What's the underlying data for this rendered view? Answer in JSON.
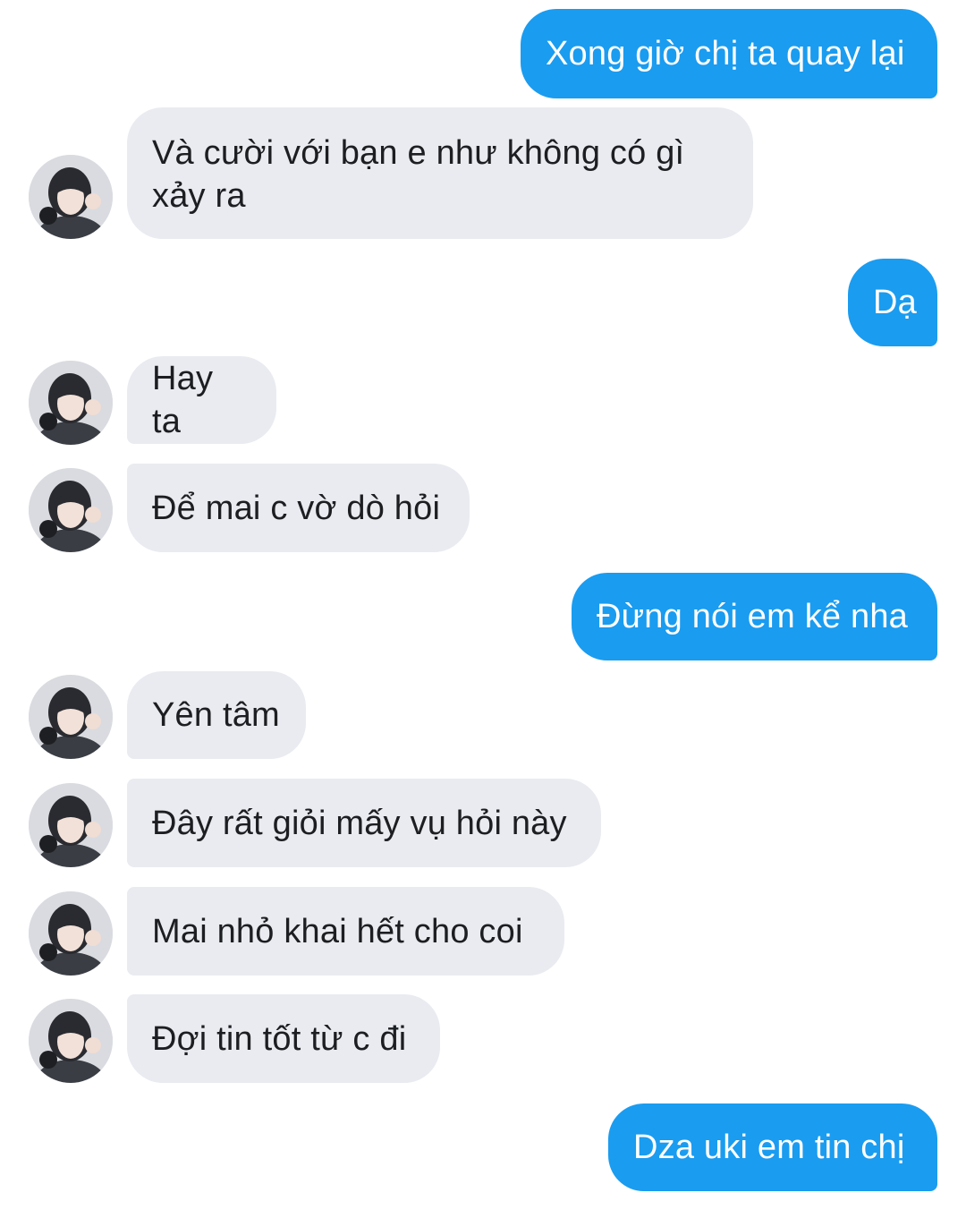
{
  "colors": {
    "outgoing_bubble": "#1a9cf0",
    "incoming_bubble": "#e9ebf0",
    "incoming_text": "#1c1e21",
    "outgoing_text": "#ffffff"
  },
  "messages": [
    {
      "sender": "me",
      "text": "Xong giờ chị ta quay lại"
    },
    {
      "sender": "other",
      "text": "Và cười với bạn e như không có gì\nxảy ra",
      "avatar": "profile-photo"
    },
    {
      "sender": "me",
      "text": "Dạ"
    },
    {
      "sender": "other",
      "text": "Hay ta",
      "avatar": "profile-photo"
    },
    {
      "sender": "other",
      "text": "Để mai c vờ dò hỏi",
      "avatar": "profile-photo"
    },
    {
      "sender": "me",
      "text": "Đừng nói em kể nha"
    },
    {
      "sender": "other",
      "text": "Yên tâm",
      "avatar": "profile-photo"
    },
    {
      "sender": "other",
      "text": "Đây rất giỏi mấy vụ hỏi này",
      "avatar": "profile-photo"
    },
    {
      "sender": "other",
      "text": "Mai nhỏ khai hết cho coi",
      "avatar": "profile-photo"
    },
    {
      "sender": "other",
      "text": "Đợi tin tốt từ c đi",
      "avatar": "profile-photo"
    },
    {
      "sender": "me",
      "text": "Dza uki em tin chị"
    }
  ]
}
